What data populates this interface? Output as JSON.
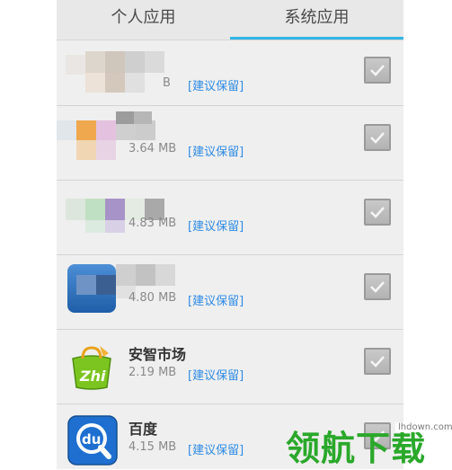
{
  "tabs": {
    "personal": "个人应用",
    "system": "系统应用",
    "active": "system"
  },
  "apps": [
    {
      "name": "",
      "size": "B",
      "tag": "[建议保留]",
      "checked": true
    },
    {
      "name": "",
      "size": "3.64 MB",
      "tag": "[建议保留]",
      "checked": true
    },
    {
      "name": "",
      "size": "4.83 MB",
      "tag": "[建议保留]",
      "checked": true
    },
    {
      "name": "",
      "size": "4.80 MB",
      "tag": "[建议保留]",
      "checked": true
    },
    {
      "name": "安智市场",
      "size": "2.19 MB",
      "tag": "[建议保留]",
      "checked": true
    },
    {
      "name": "百度",
      "size": "4.15 MB",
      "tag": "[建议保留]",
      "checked": true
    }
  ],
  "watermark": {
    "site": "lhdown.com",
    "logo": "领航下载"
  },
  "colors": {
    "accent": "#33b5e5",
    "tag": "#2e8be6",
    "anzhi": "#7cc520",
    "baidu": "#1f6fd1"
  },
  "icons": [
    "pixelated-app-icon",
    "pixelated-app-icon",
    "pixelated-app-icon",
    "pixelated-app-icon",
    "anzhi-bag-icon",
    "baidu-du-icon"
  ]
}
